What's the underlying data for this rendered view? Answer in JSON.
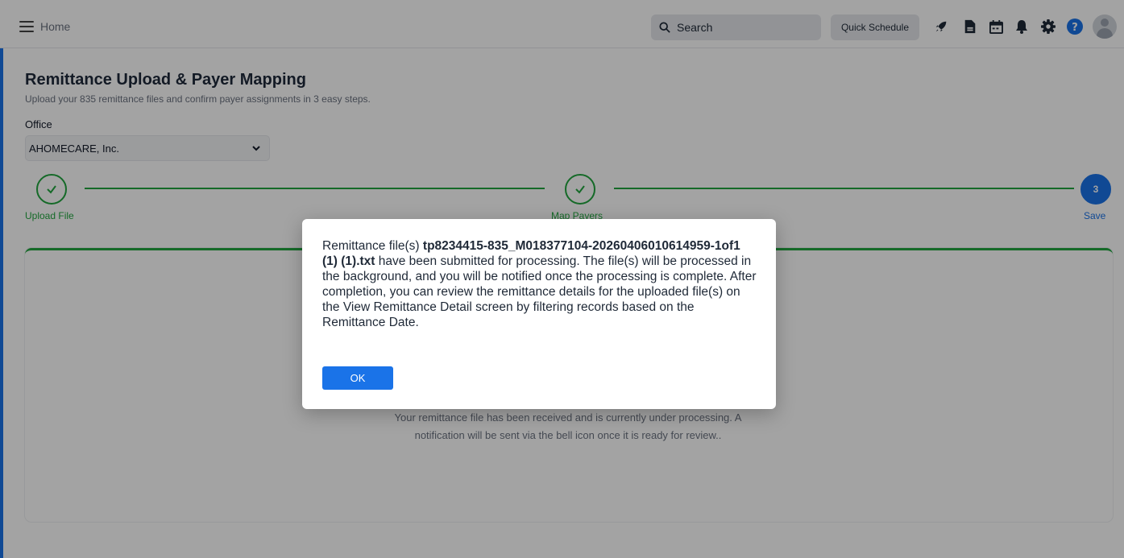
{
  "header": {
    "home_label": "Home",
    "search_placeholder": "Search",
    "quick_schedule_label": "Quick Schedule",
    "icons": [
      "menu-icon",
      "search-icon",
      "rocket-icon",
      "document-icon",
      "calendar-icon",
      "bell-icon",
      "gear-icon",
      "help-icon",
      "avatar"
    ]
  },
  "page": {
    "title": "Remittance Upload & Payer Mapping",
    "subtitle": "Upload your 835 remittance files and confirm payer assignments in 3 easy steps.",
    "office_label": "Office",
    "office_value": "AHOMECARE, Inc."
  },
  "stepper": {
    "steps": [
      {
        "label": "Upload File",
        "state": "complete"
      },
      {
        "label": "Map Payers",
        "state": "complete"
      },
      {
        "label": "Save",
        "number": "3",
        "state": "active"
      }
    ]
  },
  "card": {
    "message": "Your remittance file has been received and is currently under processing. A notification will be sent via the bell icon once it is ready for review.."
  },
  "modal": {
    "text_prefix": "Remittance file(s) ",
    "file_name": "tp8234415-835_M018377104-20260406010614959-1of1 (1) (1).txt",
    "text_suffix": " have been submitted for processing. The file(s) will be processed in the background, and you will be notified once the processing is complete. After completion, you can review the remittance details for the uploaded file(s) on the View Remittance Detail screen by filtering records based on the Remittance Date.",
    "ok_label": "OK"
  },
  "colors": {
    "accent": "#1a73e8",
    "success": "#22a63f",
    "title": "#1e293b"
  }
}
